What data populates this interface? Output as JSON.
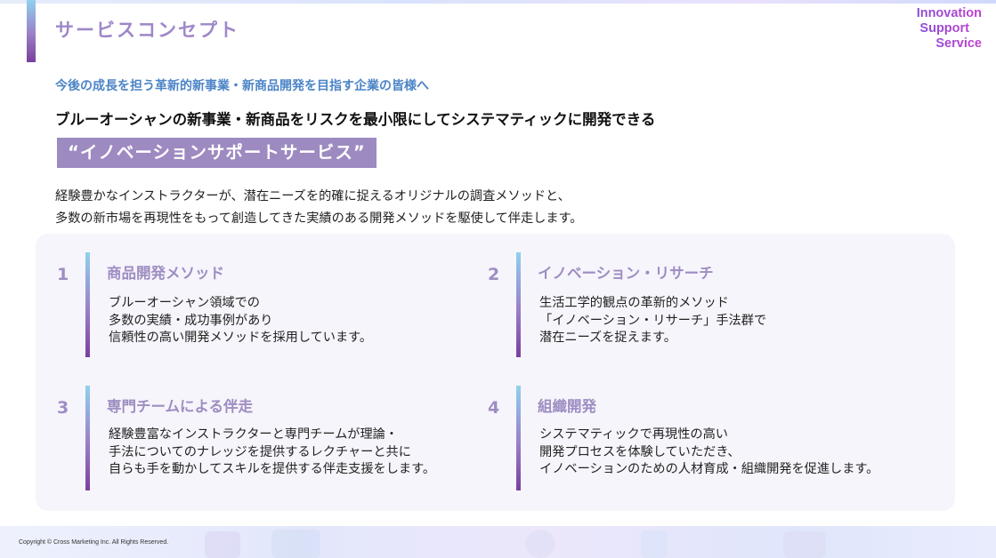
{
  "header": {
    "title": "サービスコンセプト",
    "logo_lines": [
      "Innovation",
      "Support",
      "Service"
    ]
  },
  "lead": "今後の成長を担う革新的新事業・新商品開発を目指す企業の皆様へ",
  "headline": "ブルーオーシャンの新事業・新商品をリスクを最小限にしてシステマティックに開発できる",
  "service_name": "“イノベーションサポートサービス”",
  "intro_lines": [
    "経験豊かなインストラクターが、潜在ニーズを的確に捉えるオリジナルの調査メソッドと、",
    "多数の新市場を再現性をもって創造してきた実績のある開発メソッドを駆使して伴走します。"
  ],
  "features": [
    {
      "number": "1",
      "title": "商品開発メソッド",
      "lines": [
        "ブルーオーシャン領域での",
        "多数の実績・成功事例があり",
        "信頼性の高い開発メソッドを採用しています。"
      ]
    },
    {
      "number": "2",
      "title": "イノベーション・リサーチ",
      "lines": [
        "生活工学的観点の革新的メソッド",
        "「イノベーション・リサーチ」手法群で",
        "潜在ニーズを捉えます。"
      ]
    },
    {
      "number": "3",
      "title": "専門チームによる伴走",
      "lines": [
        "経験豊富なインストラクターと専門チームが理論・",
        "手法についてのナレッジを提供するレクチャーと共に",
        "自らも手を動かしてスキルを提供する伴走支援をします。"
      ]
    },
    {
      "number": "4",
      "title": "組織開発",
      "lines": [
        "システマティックで再現性の高い",
        "開発プロセスを体験していただき、",
        "イノベーションのための人材育成・組織開発を促進します。"
      ]
    }
  ],
  "footer": {
    "copyright": "Copyright © Cross Marketing Inc. All Rights Reserved."
  },
  "colors": {
    "title": "#9f87c8",
    "lead": "#4b84c6",
    "service_bg": "#9d8ac1",
    "feature_accent": "#9e8dc2",
    "panel_bg": "#f6f5fb"
  }
}
